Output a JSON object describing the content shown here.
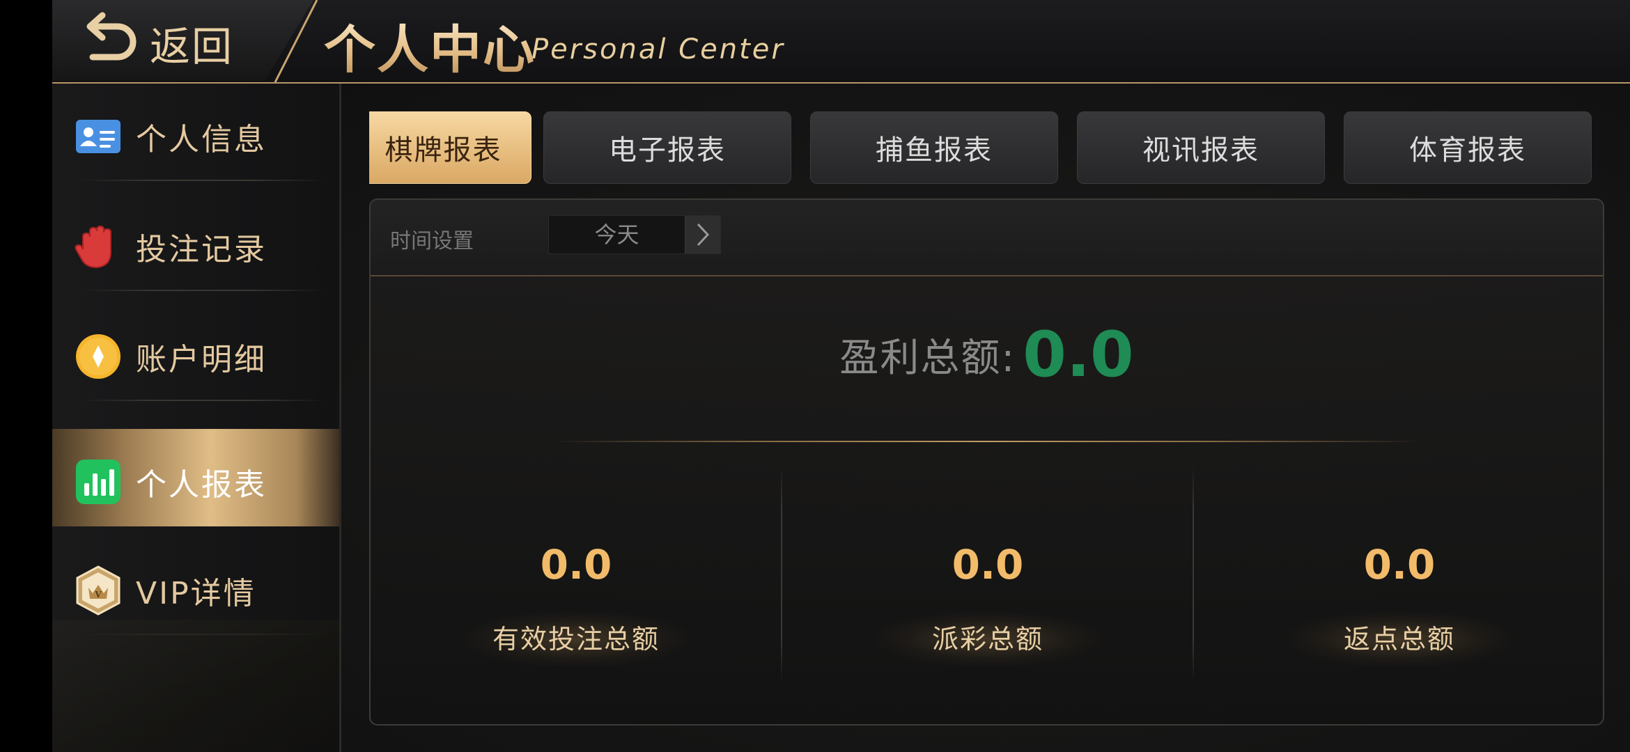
{
  "header": {
    "back_label": "返回",
    "title_cn": "个人中心",
    "title_en": "Personal Center"
  },
  "sidebar": {
    "items": [
      {
        "label": "个人信息",
        "icon": "id-card-icon",
        "active": false
      },
      {
        "label": "投注记录",
        "icon": "red-hand-icon",
        "active": false
      },
      {
        "label": "账户明细",
        "icon": "gold-coin-icon",
        "active": false
      },
      {
        "label": "个人报表",
        "icon": "bar-chart-icon",
        "active": true
      },
      {
        "label": "VIP详情",
        "icon": "vip-crown-badge-icon",
        "active": false
      }
    ]
  },
  "tabs": [
    {
      "label": "棋牌报表",
      "active": true
    },
    {
      "label": "电子报表",
      "active": false
    },
    {
      "label": "捕鱼报表",
      "active": false
    },
    {
      "label": "视讯报表",
      "active": false
    },
    {
      "label": "体育报表",
      "active": false
    }
  ],
  "filter": {
    "label": "时间设置",
    "date_value": "今天"
  },
  "profit": {
    "label": "盈利总额:",
    "value": "0.0"
  },
  "stats": [
    {
      "value": "0.0",
      "label": "有效投注总额"
    },
    {
      "value": "0.0",
      "label": "派彩总额"
    },
    {
      "value": "0.0",
      "label": "返点总额"
    }
  ],
  "colors": {
    "gold": "#e8cfa4",
    "profit_green": "#1e8c54",
    "stat_orange": "#f2bb6a",
    "tab_active": "#e6bb7c"
  }
}
